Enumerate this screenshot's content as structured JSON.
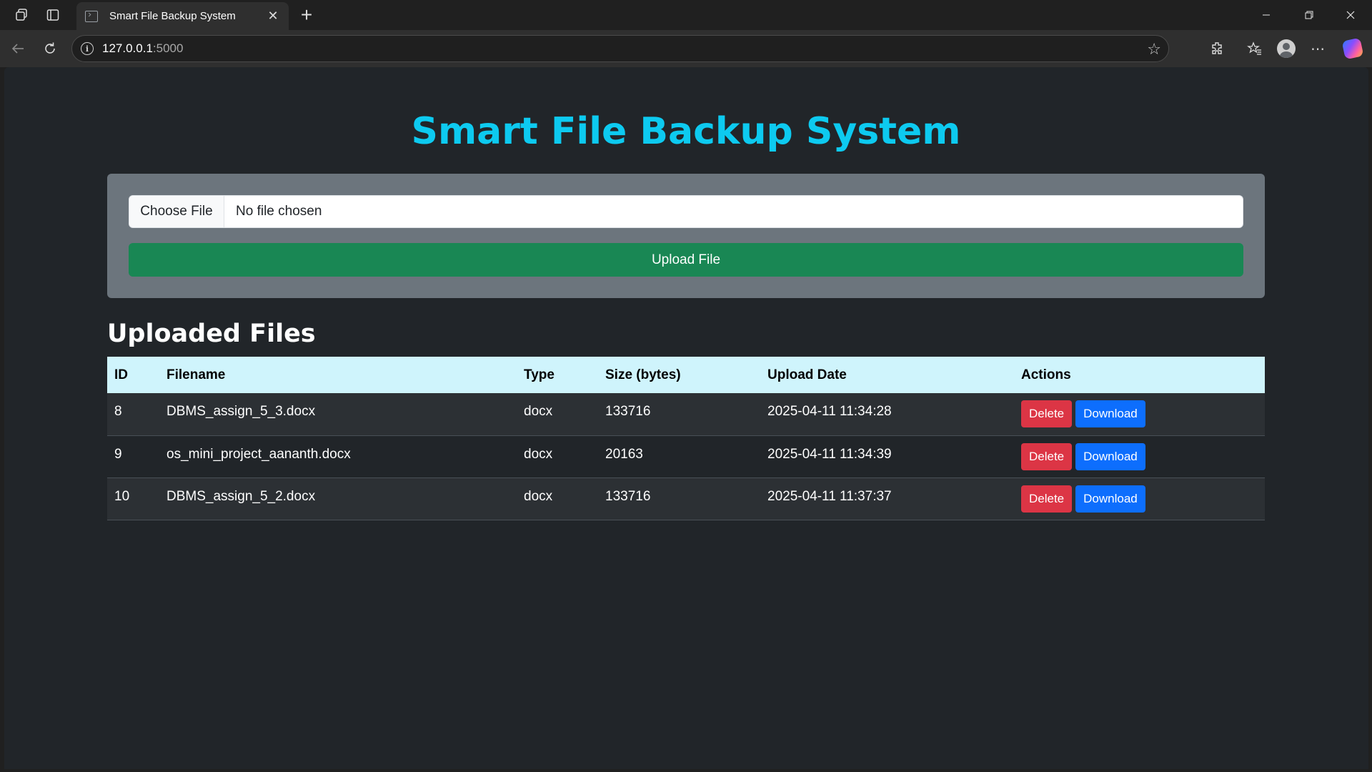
{
  "browser": {
    "tab_title": "Smart File Backup System",
    "url_host": "127.0.0.1",
    "url_port": ":5000"
  },
  "page": {
    "title": "Smart File Backup System",
    "upload": {
      "choose_label": "Choose File",
      "file_status": "No file chosen",
      "upload_label": "Upload File"
    },
    "section_title": "Uploaded Files",
    "table": {
      "headers": [
        "ID",
        "Filename",
        "Type",
        "Size (bytes)",
        "Upload Date",
        "Actions"
      ],
      "rows": [
        {
          "id": "8",
          "filename": "DBMS_assign_5_3.docx",
          "type": "docx",
          "size": "133716",
          "date": "2025-04-11 11:34:28"
        },
        {
          "id": "9",
          "filename": "os_mini_project_aananth.docx",
          "type": "docx",
          "size": "20163",
          "date": "2025-04-11 11:34:39"
        },
        {
          "id": "10",
          "filename": "DBMS_assign_5_2.docx",
          "type": "docx",
          "size": "133716",
          "date": "2025-04-11 11:37:37"
        }
      ],
      "delete_label": "Delete",
      "download_label": "Download"
    }
  },
  "colors": {
    "title": "#0dcaf0",
    "card": "#6c757d",
    "upload_button": "#198754",
    "table_header": "#cff4fc",
    "delete": "#dc3545",
    "download": "#0d6efd"
  }
}
